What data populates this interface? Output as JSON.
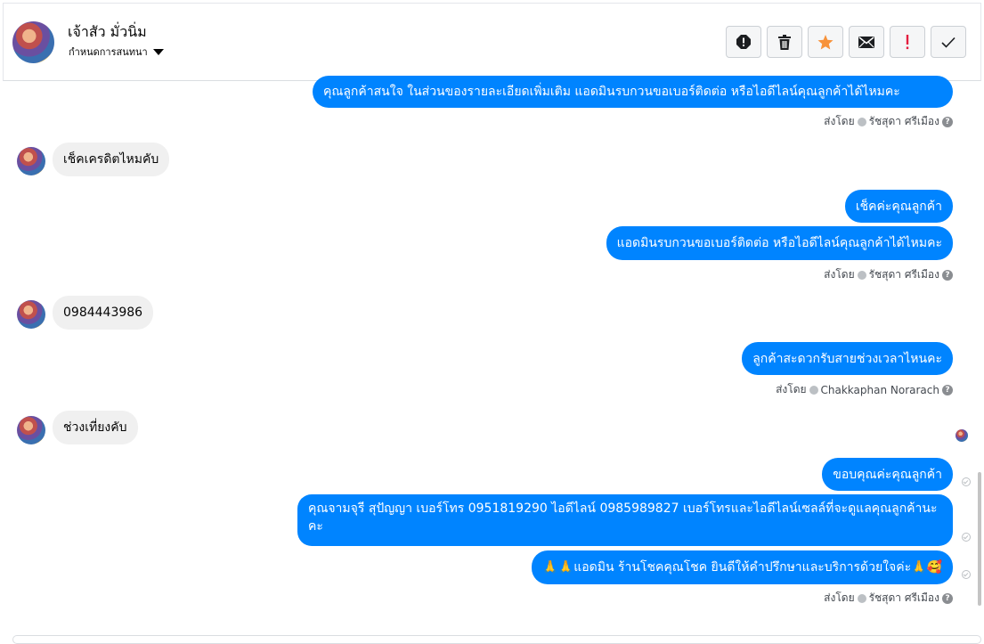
{
  "header": {
    "contact_name": "เจ้าสัว มั่วนิ่ม",
    "subtitle": "กำหนดการสนทนา",
    "actions": [
      "mark-spam",
      "delete",
      "star",
      "mail",
      "important",
      "done"
    ]
  },
  "messages": {
    "m1": "คุณลูกค้าสนใจ ในส่วนของรายละเอียดเพิ่มเติม แอดมินรบกวนขอเบอร์ติดต่อ หรือไอดีไลน์คุณลูกค้าได้ไหมคะ",
    "m2": "เช็คเครดิตไหมคับ",
    "m3": "เช็คค่ะคุณลูกค้า",
    "m4": "แอดมินรบกวนขอเบอร์ติดต่อ หรือไอดีไลน์คุณลูกค้าได้ไหมคะ",
    "m5": "0984443986",
    "m6": "ลูกค้าสะดวกรับสายช่วงเวลาไหนคะ",
    "m7": "ช่วงเที่ยงคับ",
    "m8": "ขอบคุณค่ะคุณลูกค้า",
    "m9": "คุณจามจุรี สุปัญญา เบอร์โทร 0951819290  ไอดีไลน์ 0985989827  เบอร์โทรและไอดีไลน์เซลล์ที่จะดูแลคุณลูกค้านะคะ",
    "m10": "🙏🙏แอดมิน ร้านโชคคุณโชค ยินดีให้คำปรึกษาและบริการด้วยใจค่ะ🙏🥰"
  },
  "sent_by": {
    "label": "ส่งโดย",
    "s1": "รัชสุดา ศรีเมือง",
    "s2": "รัชสุดา ศรีเมือง",
    "s3": "Chakkaphan Norarach",
    "s4": "รัชสุดา ศรีเมือง"
  },
  "colors": {
    "outgoing_bubble": "#0084ff",
    "incoming_bubble": "#f0f0f0",
    "star": "#f7923a",
    "important": "#e41e3f"
  }
}
